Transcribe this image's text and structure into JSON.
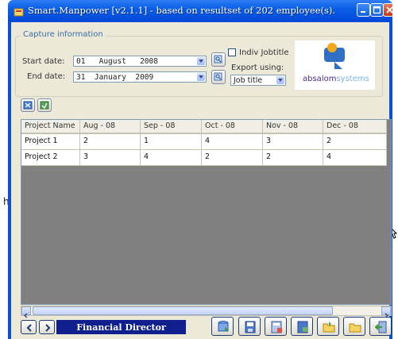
{
  "window": {
    "title": "Smart.Manpower [v2.1.1] - based on resultset of 202 employee(s)."
  },
  "capture": {
    "legend": "Capture information",
    "start_label": "Start date:",
    "start_value": "01   August   2008",
    "end_label": "End date:",
    "end_value": "31  January  2009",
    "indiv_label": "Indiv Jobtitle",
    "export_label": "Export using:",
    "export_value": "Job title"
  },
  "logo": {
    "text_a": "absalom",
    "text_b": "systems"
  },
  "grid": {
    "columns": [
      "Project Name",
      "Aug - 08",
      "Sep - 08",
      "Oct - 08",
      "Nov - 08",
      "Dec - 08"
    ],
    "rows": [
      [
        "Project 1",
        "2",
        "1",
        "4",
        "3",
        "2"
      ],
      [
        "Project 2",
        "3",
        "4",
        "2",
        "2",
        "4"
      ]
    ]
  },
  "footer": {
    "status": "Financial Director"
  },
  "outside": {
    "fragment": "h"
  },
  "colors": {
    "title_bar": "#0a5ee6",
    "status_bg": "#0f1f8e",
    "client_bg": "#ece9d8",
    "grid_empty": "#808080"
  }
}
